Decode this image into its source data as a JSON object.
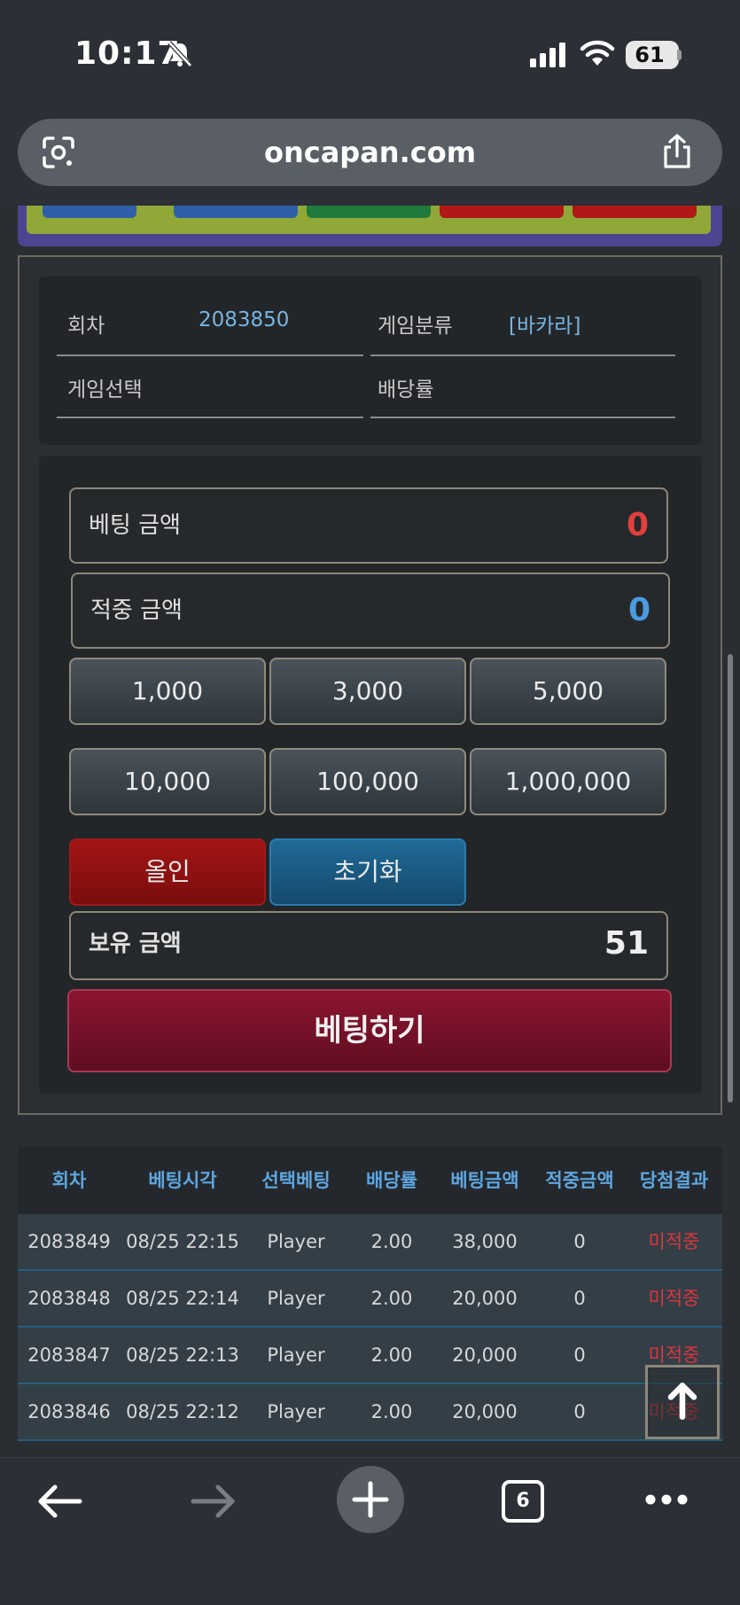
{
  "status_bar": {
    "time": "10:17",
    "battery": "61"
  },
  "browser": {
    "url": "oncapan.com",
    "tab_count": "6"
  },
  "info": {
    "round_label": "회차",
    "round_value": "2083850",
    "category_label": "게임분류",
    "category_value": "[바카라]",
    "select_label": "게임선택",
    "odds_label": "배당률"
  },
  "bet": {
    "bet_amount_label": "베팅 금액",
    "bet_amount_value": "0",
    "win_amount_label": "적중 금액",
    "win_amount_value": "0",
    "amount_buttons": [
      "1,000",
      "3,000",
      "5,000",
      "10,000",
      "100,000",
      "1,000,000"
    ],
    "allin_label": "올인",
    "reset_label": "초기화",
    "balance_label": "보유 금액",
    "balance_value": "51",
    "submit_label": "베팅하기"
  },
  "history": {
    "headers": [
      "회차",
      "베팅시각",
      "선택베팅",
      "배당률",
      "베팅금액",
      "적중금액",
      "당첨결과"
    ],
    "rows": [
      [
        "2083849",
        "08/25 22:15",
        "Player",
        "2.00",
        "38,000",
        "0",
        "미적중"
      ],
      [
        "2083848",
        "08/25 22:14",
        "Player",
        "2.00",
        "20,000",
        "0",
        "미적중"
      ],
      [
        "2083847",
        "08/25 22:13",
        "Player",
        "2.00",
        "20,000",
        "0",
        "미적중"
      ],
      [
        "2083846",
        "08/25 22:12",
        "Player",
        "2.00",
        "20,000",
        "0",
        "미적중"
      ]
    ]
  },
  "colors": {
    "bet_amount": "#e0403c",
    "win_amount": "#4a9be0",
    "balance": "#eeeeee",
    "strip_buttons": [
      "#2f5fa8",
      "#2f5fa8",
      "#1f7a3c",
      "#b01818",
      "#b01818"
    ]
  }
}
